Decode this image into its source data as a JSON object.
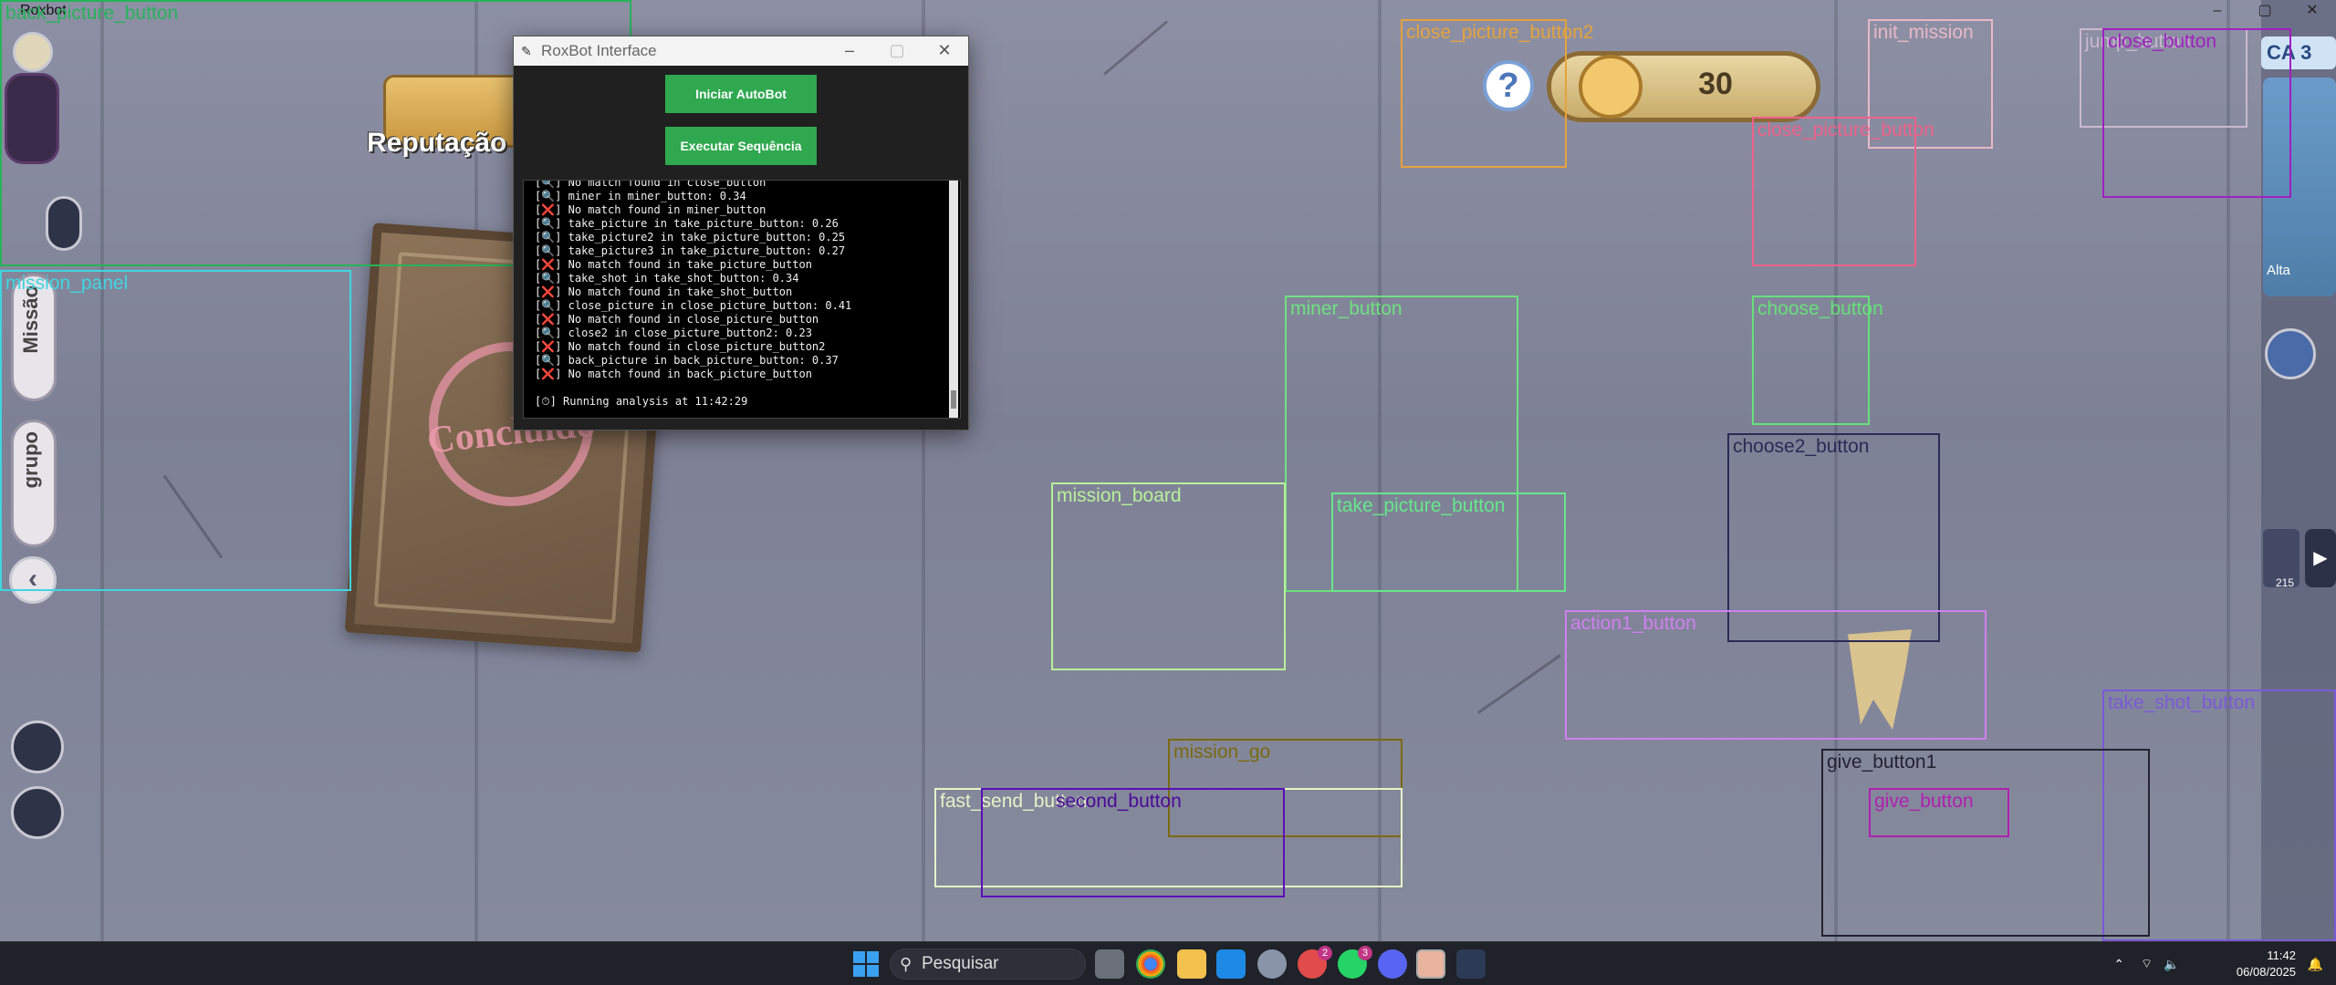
{
  "window": {
    "title": "Roxbot",
    "controls": [
      "–",
      "▢",
      "✕"
    ]
  },
  "game": {
    "reputation_label": "Reputação d",
    "stamp_text": "Concluído",
    "energy_value": "30",
    "help_label": "?",
    "side_tabs": [
      "Missão",
      "grupo"
    ],
    "stage_tag": "CA 3",
    "altitude_label": "Alta",
    "thumbnail_count": "215"
  },
  "detections": [
    {
      "name": "back-picture-button-box",
      "label": "back_picture_button",
      "color": "#26b35a"
    },
    {
      "name": "mission-panel-box",
      "label": "mission_panel",
      "color": "#3fd6e0"
    },
    {
      "name": "close-picture-button2-box",
      "label": "close_picture_button2",
      "color": "#e6a23c"
    },
    {
      "name": "init-mission-box",
      "label": "init_mission",
      "color": "#e8b8c8"
    },
    {
      "name": "jump-button-box",
      "label": "jump_button",
      "color": "#c9b9cf"
    },
    {
      "name": "close-button-box",
      "label": "close_button",
      "color": "#a020c0"
    },
    {
      "name": "close-picture-button-box",
      "label": "close_picture_button",
      "color": "#f0608a"
    },
    {
      "name": "miner-button-box",
      "label": "miner_button",
      "color": "#6fe080"
    },
    {
      "name": "choose-button-box",
      "label": "choose_button",
      "color": "#66e07a"
    },
    {
      "name": "choose2-button-box",
      "label": "choose2_button",
      "color": "#2b2a55"
    },
    {
      "name": "mission-board-box",
      "label": "mission_board",
      "color": "#b9f09a"
    },
    {
      "name": "take-picture-button-box",
      "label": "take_picture_button",
      "color": "#66e88a"
    },
    {
      "name": "action1-button-box",
      "label": "action1_button",
      "color": "#d07ff0"
    },
    {
      "name": "take-shot-button-box",
      "label": "take_shot_button",
      "color": "#7a5ad8"
    },
    {
      "name": "mission-go-box",
      "label": "mission_go",
      "color": "#7a6a10"
    },
    {
      "name": "fast-send-button-box",
      "label": "fast_send_button",
      "color": "#e6f2c8"
    },
    {
      "name": "second-button-box",
      "label": "second_button",
      "color": "#5a10b8"
    },
    {
      "name": "give-button1-box",
      "label": "give_button1",
      "color": "#222233"
    },
    {
      "name": "give-button-box",
      "label": "give_button",
      "color": "#b020b0"
    }
  ],
  "bot": {
    "title": "RoxBot Interface",
    "start_label": "Iniciar AutoBot",
    "sequence_label": "Executar Sequência",
    "log": [
      "[🔍] No match found in close_button",
      "[🔍] miner in miner_button: 0.34",
      "[❌] No match found in miner_button",
      "[🔍] take_picture in take_picture_button: 0.26",
      "[🔍] take_picture2 in take_picture_button: 0.25",
      "[🔍] take_picture3 in take_picture_button: 0.27",
      "[❌] No match found in take_picture_button",
      "[🔍] take_shot in take_shot_button: 0.34",
      "[❌] No match found in take_shot_button",
      "[🔍] close_picture in close_picture_button: 0.41",
      "[❌] No match found in close_picture_button",
      "[🔍] close2 in close_picture_button2: 0.23",
      "[❌] No match found in close_picture_button2",
      "[🔍] back_picture in back_picture_button: 0.37",
      "[❌] No match found in back_picture_button",
      "",
      "[⏱] Running analysis at 11:42:29"
    ]
  },
  "taskbar": {
    "search_placeholder": "Pesquisar",
    "badge_edge": "2",
    "badge_whatsapp": "3",
    "time": "11:42",
    "date": "06/08/2025"
  },
  "colors": {
    "accent_green": "#2fa84f",
    "taskbar": "#1f2228"
  }
}
